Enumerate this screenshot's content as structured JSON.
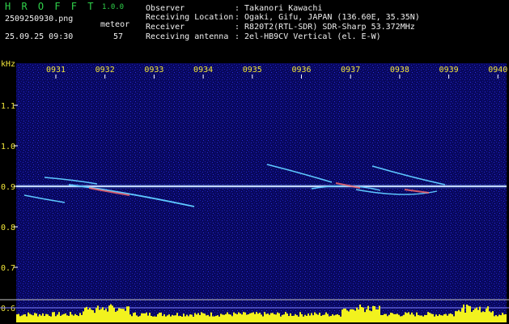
{
  "header": {
    "app_name": "H R O F F T",
    "version": "1.0.0",
    "filename": "2509250930.png",
    "datetime": "25.09.25 09:30",
    "meteor_label": "meteor",
    "meteor_count": "57"
  },
  "info": [
    {
      "label": "Observer",
      "value": ": Takanori Kawachi"
    },
    {
      "label": "Receiving Location",
      "value": ": Ogaki, Gifu, JAPAN (136.60E, 35.35N)"
    },
    {
      "label": "Receiver",
      "value": ": R820T2(RTL-SDR) SDR-Sharp 53.372MHz"
    },
    {
      "label": "Receiving antenna",
      "value": ": 2el-HB9CV Vertical (el. E-W)"
    }
  ],
  "spectrogram": {
    "unit_label": "kHz",
    "time_ticks": [
      "0931",
      "0932",
      "0933",
      "0934",
      "0935",
      "0936",
      "0937",
      "0938",
      "0939",
      "0940"
    ],
    "freq_ticks": [
      {
        "label": "1.1",
        "value": 1.1
      },
      {
        "label": "1.0",
        "value": 1.0
      },
      {
        "label": "0.9",
        "value": 0.9
      },
      {
        "label": "0.8",
        "value": 0.8
      },
      {
        "label": "0.7",
        "value": 0.7
      },
      {
        "label": "0.6",
        "value": 0.6
      }
    ],
    "colors": {
      "background": "#0a0a6e",
      "carrier": "#dfe6ff",
      "trail": "#5ec8ff",
      "hot": "#ff6b6b",
      "histogram": "#f2f21e",
      "axis": "#ffffff",
      "tick_text": "#f2e63a"
    }
  }
}
